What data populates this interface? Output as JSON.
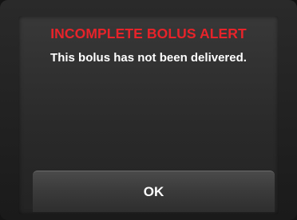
{
  "alert": {
    "title": "INCOMPLETE BOLUS ALERT",
    "message": "This bolus has not been delivered.",
    "ok_label": "OK"
  },
  "colors": {
    "title": "#e8232a",
    "text": "#ffffff",
    "background": "#2e2e2e"
  }
}
